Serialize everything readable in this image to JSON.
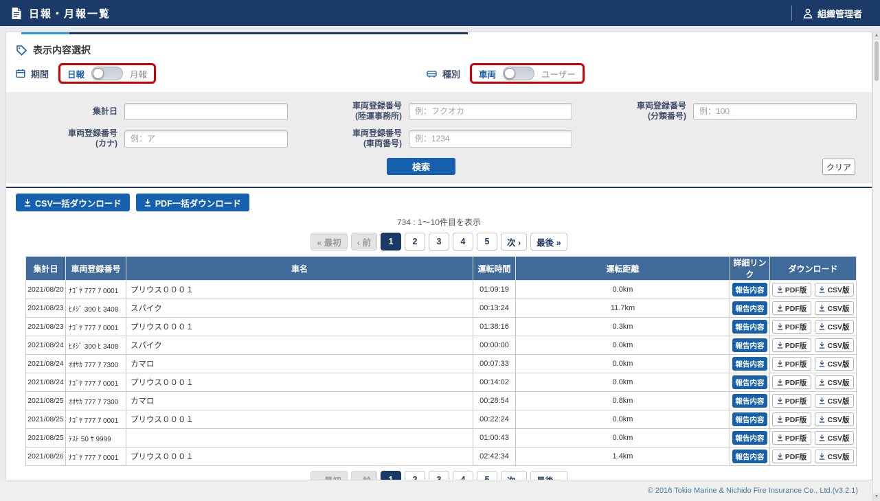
{
  "header": {
    "title": "日報・月報一覧",
    "user_role": "組織管理者"
  },
  "filter": {
    "section_title": "表示内容選択",
    "period": {
      "label": "期間",
      "option_on": "日報",
      "option_off": "月報"
    },
    "category": {
      "label": "種別",
      "option_on": "車両",
      "option_off": "ユーザー"
    },
    "fields": [
      {
        "label": "集計日",
        "sub": "",
        "value": "",
        "placeholder": ""
      },
      {
        "label": "車両登録番号",
        "sub": "(陸運事務所)",
        "value": "",
        "placeholder": "例：フクオカ"
      },
      {
        "label": "車両登録番号",
        "sub": "(分類番号)",
        "value": "",
        "placeholder": "例：100"
      },
      {
        "label": "車両登録番号",
        "sub": "(カナ)",
        "value": "",
        "placeholder": "例：ア"
      },
      {
        "label": "車両登録番号",
        "sub": "(車両番号)",
        "value": "",
        "placeholder": "例：1234"
      }
    ],
    "search_label": "検索",
    "clear_label": "クリア"
  },
  "toolbar": {
    "csv_bulk": "CSV一括ダウンロード",
    "pdf_bulk": "PDF一括ダウンロード"
  },
  "pagination": {
    "count_text": "734 : 1〜10件目を表示",
    "first": "« 最初",
    "prev": "‹ 前",
    "pages": [
      "1",
      "2",
      "3",
      "4",
      "5"
    ],
    "active_page": "1",
    "next": "次 ›",
    "last": "最後 »"
  },
  "table": {
    "headers": [
      "集計日",
      "車両登録番号",
      "車名",
      "運転時間",
      "運転距離",
      "詳細リンク",
      "ダウンロード"
    ],
    "report_button": "報告内容",
    "pdf_button": "PDF版",
    "csv_button": "CSV版",
    "rows": [
      {
        "date": "2021/08/20",
        "reg": "ﾅｺﾞﾔ 777 ｱ 0001",
        "car": "プリウス０００１",
        "time": "01:09:19",
        "dist": "0.0km"
      },
      {
        "date": "2021/08/23",
        "reg": "ﾋﾒｼﾞ 300 ﾋ 3408",
        "car": "スパイク",
        "time": "00:13:24",
        "dist": "11.7km"
      },
      {
        "date": "2021/08/23",
        "reg": "ﾅｺﾞﾔ 777 ｱ 0001",
        "car": "プリウス０００１",
        "time": "01:38:16",
        "dist": "0.3km"
      },
      {
        "date": "2021/08/24",
        "reg": "ﾋﾒｼﾞ 300 ﾋ 3408",
        "car": "スパイク",
        "time": "00:00:00",
        "dist": "0.0km"
      },
      {
        "date": "2021/08/24",
        "reg": "ｵｵｻｶ 777 ｱ 7300",
        "car": "カマロ",
        "time": "00:07:33",
        "dist": "0.0km"
      },
      {
        "date": "2021/08/24",
        "reg": "ﾅｺﾞﾔ 777 ｱ 0001",
        "car": "プリウス０００１",
        "time": "00:14:02",
        "dist": "0.0km"
      },
      {
        "date": "2021/08/25",
        "reg": "ｵｵｻｶ 777 ｱ 7300",
        "car": "カマロ",
        "time": "00:28:54",
        "dist": "0.8km"
      },
      {
        "date": "2021/08/25",
        "reg": "ﾅｺﾞﾔ 777 ｱ 0001",
        "car": "プリウス０００１",
        "time": "00:22:24",
        "dist": "0.0km"
      },
      {
        "date": "2021/08/25",
        "reg": "ﾃｽﾄ 50 ｻ 9999",
        "car": "",
        "time": "01:00:43",
        "dist": "0.0km"
      },
      {
        "date": "2021/08/26",
        "reg": "ﾅｺﾞﾔ 777 ｱ 0001",
        "car": "プリウス０００１",
        "time": "02:42:34",
        "dist": "1.4km"
      }
    ]
  },
  "footer": {
    "copyright": "© 2016 Tokio Marine & Nichido Fire Insurance Co., Ltd.(v3.2.1)"
  },
  "colors": {
    "header_bg": "#1b3a67",
    "table_header_bg": "#3f6a99",
    "primary_button": "#1660ae",
    "highlight_red": "#d10000",
    "tab_accent": "#2d9ad1",
    "active_page_bg": "#1b3a67"
  }
}
